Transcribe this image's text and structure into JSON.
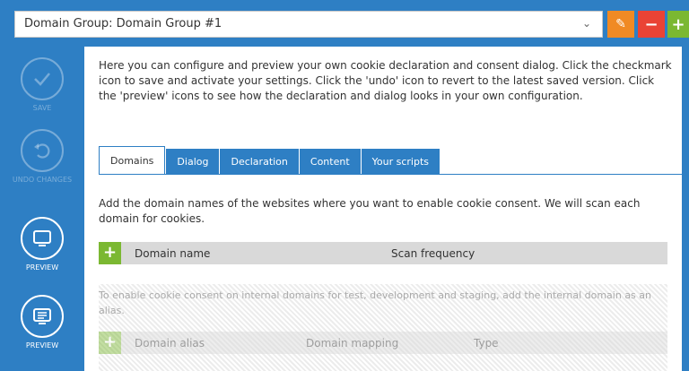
{
  "header": {
    "group_select_value": "Domain Group: Domain Group #1",
    "chevron_glyph": "⌄",
    "edit_glyph": "✎",
    "minus_glyph": "−",
    "plus_glyph": "+"
  },
  "sidebar": {
    "save_label": "SAVE",
    "undo_label": "UNDO CHANGES",
    "preview1_label": "PREVIEW",
    "preview2_label": "PREVIEW"
  },
  "main": {
    "intro": "Here you can configure and preview your own cookie declaration and consent dialog. Click the checkmark icon to save and activate your settings. Click the 'undo' icon to revert to the latest saved version. Click the 'preview' icons to see how the declaration and dialog looks in your own configuration.",
    "tabs": [
      {
        "label": "Domains"
      },
      {
        "label": "Dialog"
      },
      {
        "label": "Declaration"
      },
      {
        "label": "Content"
      },
      {
        "label": "Your scripts"
      }
    ],
    "domains_desc": "Add the domain names of the websites where you want to enable cookie consent. We will scan each domain for cookies.",
    "domain_table": {
      "add_glyph": "+",
      "col_domain": "Domain name",
      "col_scan": "Scan frequency"
    },
    "alias_note": "To enable cookie consent on internal domains for test, development and staging, add the internal domain as an alias.",
    "alias_table": {
      "add_glyph": "+",
      "col_alias": "Domain alias",
      "col_mapping": "Domain mapping",
      "col_type": "Type"
    }
  },
  "colors": {
    "brand_blue": "#2e7fc4",
    "orange": "#f08a24",
    "red": "#ea4335",
    "green": "#7bb832"
  }
}
